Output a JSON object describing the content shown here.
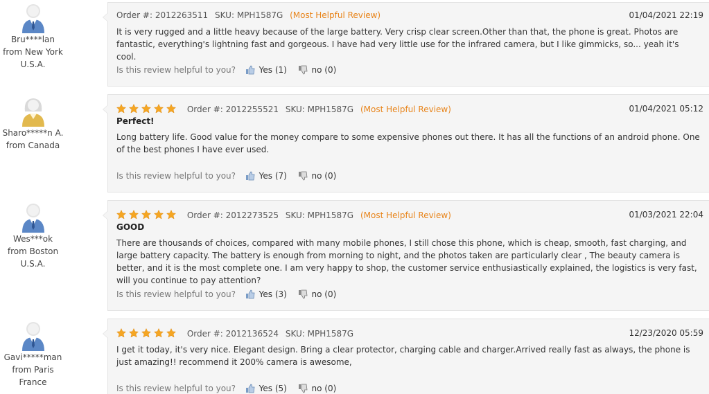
{
  "helpful_prompt": "Is this review helpful to you?",
  "reviews": [
    {
      "user_name": "Bru****lan",
      "user_location": "from New York",
      "user_country": "U.S.A.",
      "avatar_icon": "male-user-avatar-icon",
      "rating": 0,
      "order": "Order #: 2012263511",
      "sku": "SKU: MPH1587G",
      "tag": "(Most Helpful Review)",
      "date": "01/04/2021 22:19",
      "title": "",
      "text": "It is very rugged and a little heavy because of the large battery. Very crisp clear screen.Other than that, the phone is great. Photos are fantastic, everything's lightning fast and gorgeous. I have had very little use for the infrared camera, but I like gimmicks, so... yeah it's cool.",
      "yes": "Yes (1)",
      "no": "no (0)"
    },
    {
      "user_name": "Sharo*****n A.",
      "user_location": "from Canada",
      "user_country": "",
      "avatar_icon": "female-user-avatar-icon",
      "rating": 5,
      "order": "Order #: 2012255521",
      "sku": "SKU: MPH1587G",
      "tag": "(Most Helpful Review)",
      "date": "01/04/2021 05:12",
      "title": "Perfect!",
      "text": "Long battery life. Good value for the money compare to some expensive phones out there. It has all the functions of an android phone. One of the best phones I have ever used.",
      "yes": "Yes (7)",
      "no": "no (0)"
    },
    {
      "user_name": "Wes***ok",
      "user_location": "from Boston",
      "user_country": "U.S.A.",
      "avatar_icon": "male-user-avatar-icon",
      "rating": 5,
      "order": "Order #: 2012273525",
      "sku": "SKU: MPH1587G",
      "tag": "(Most Helpful Review)",
      "date": "01/03/2021 22:04",
      "title": "GOOD",
      "text": "There are thousands of choices, compared with many mobile phones, I still chose this phone, which is cheap, smooth, fast charging, and large battery capacity. The battery is enough from morning to night, and the photos taken are particularly clear , The beauty camera is better, and it is the most complete one. I am very happy to shop, the customer service enthusiastically explained, the logistics is very fast, will you continue to pay attention?",
      "yes": "Yes (3)",
      "no": "no (0)"
    },
    {
      "user_name": "Gavi*****man",
      "user_location": "from Paris",
      "user_country": "France",
      "avatar_icon": "male-user-avatar-icon",
      "rating": 5,
      "order": "Order #: 2012136524",
      "sku": "SKU: MPH1587G",
      "tag": "",
      "date": "12/23/2020 05:59",
      "title": "",
      "text": "I get it today, it's very nice. Elegant design. Bring a clear protector, charging cable and charger.Arrived really fast as always, the phone is just amazing!! recommend it 200% camera is awesome,",
      "yes": "Yes (5)",
      "no": "no (0)"
    }
  ],
  "colors": {
    "accent": "#e8841a",
    "star": "#f5a623",
    "card_bg": "#f5f5f5",
    "male_avatar": "#5b87c6",
    "female_avatar": "#e2b94e"
  }
}
